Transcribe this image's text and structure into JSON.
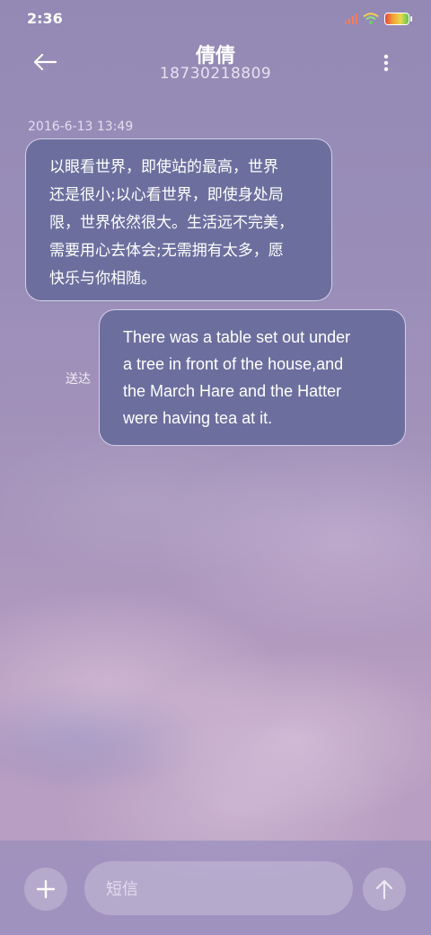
{
  "status_bar": {
    "time": "2:36",
    "battery_icon": "battery-icon",
    "wifi_icon": "wifi-icon",
    "signal_icon": "signal-icon"
  },
  "header": {
    "contact_name": "倩倩",
    "phone_number": "18730218809",
    "back_icon": "back-arrow-icon",
    "more_icon": "more-vertical-icon"
  },
  "conversation": {
    "timestamp": "2016-6-13 13:49",
    "incoming": {
      "lines": [
        "以眼看世界，即使站的最高，世界",
        "还是很小;以心看世界，即使身处局",
        "限，世界依然很大。生活远不完美，",
        "需要用心去体会;无需拥有太多，愿",
        "快乐与你相随。"
      ]
    },
    "outgoing": {
      "lines": [
        "There was a table set out under",
        "a tree in front of the house,and",
        "the March Hare and the Hatter",
        "were having tea at it."
      ],
      "status": "送达"
    }
  },
  "composer": {
    "placeholder": "短信",
    "add_icon": "plus-icon",
    "send_icon": "send-arrow-icon"
  },
  "colors": {
    "bubble": "#6c6f9e",
    "background_top": "#9489b5",
    "background_bottom": "#b89fc3"
  }
}
